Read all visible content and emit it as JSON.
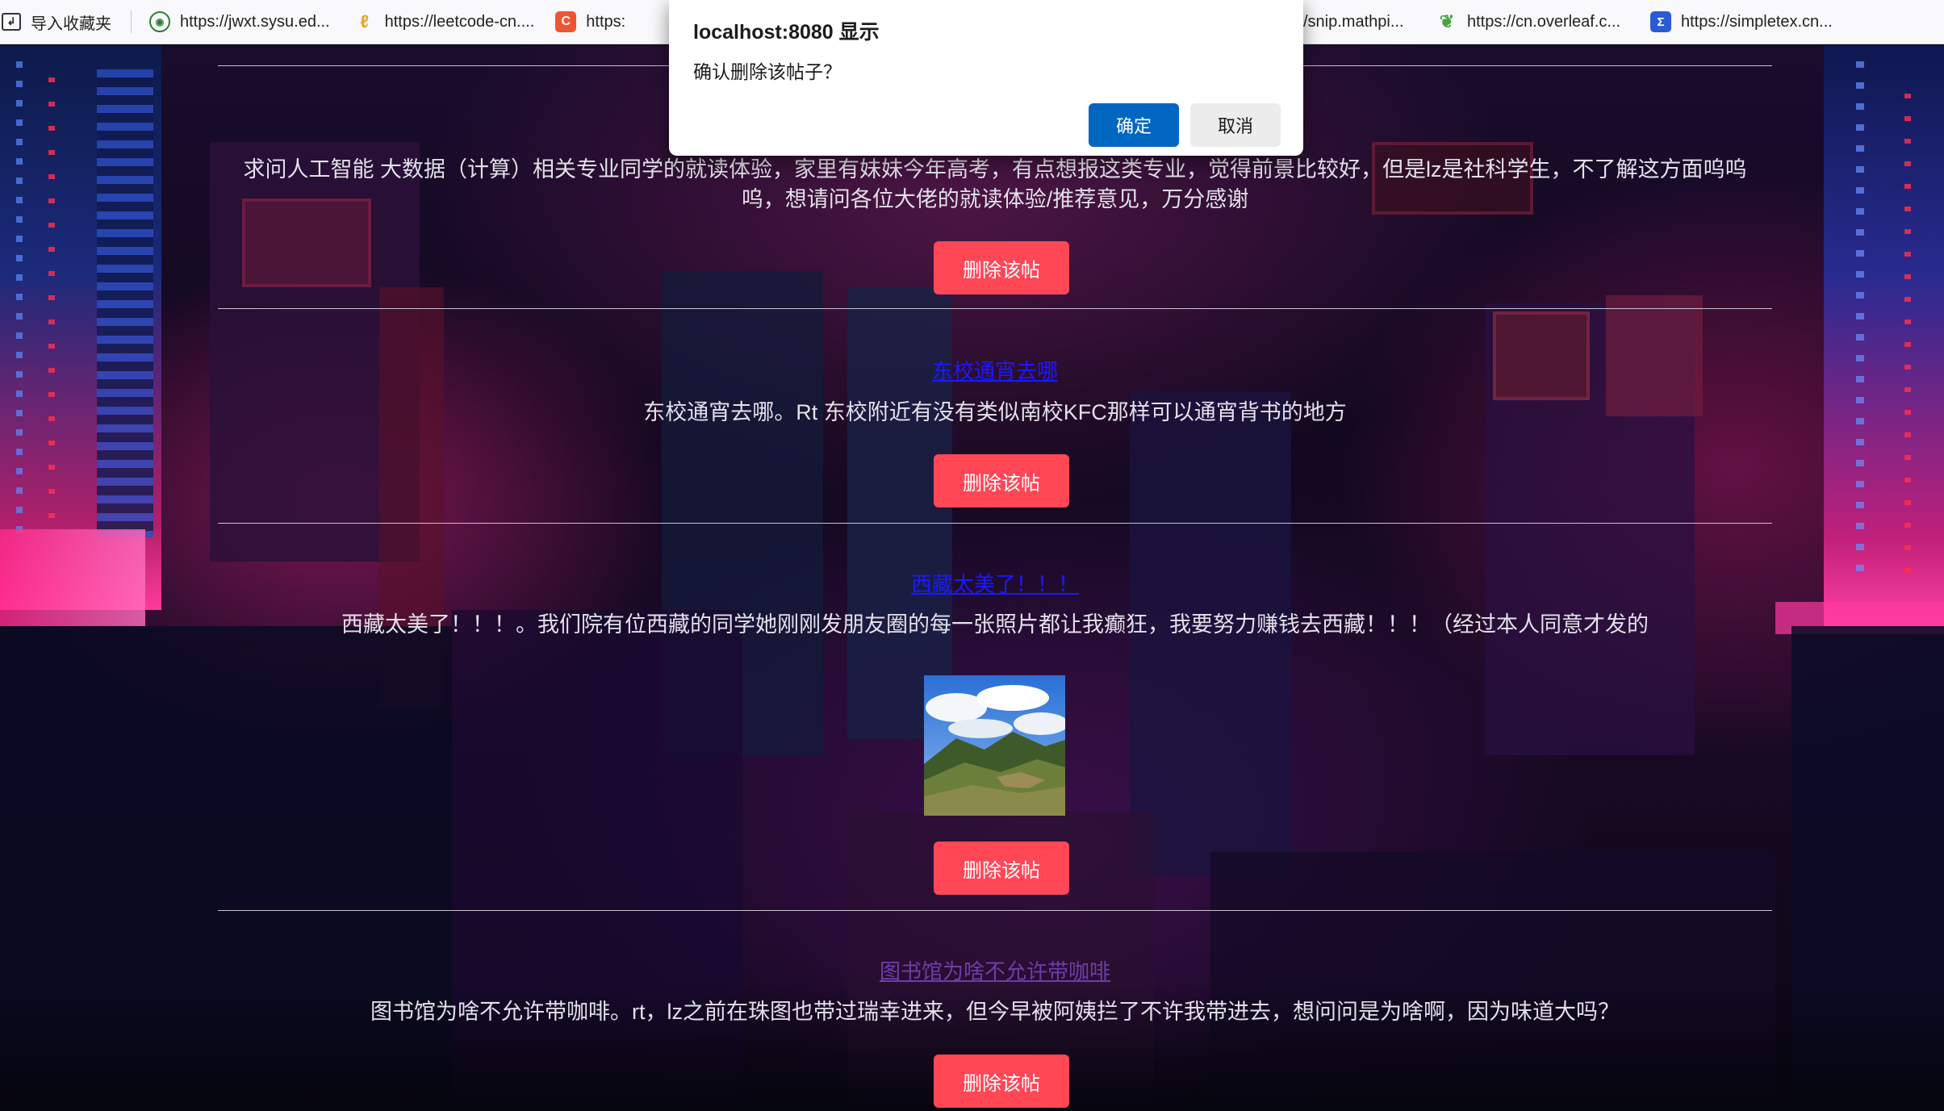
{
  "bookmarks": [
    {
      "label": "导入收藏夹",
      "icon": "import-icon"
    },
    {
      "label": "https://jwxt.sysu.ed...",
      "icon": "sysu-icon"
    },
    {
      "label": "https://leetcode-cn....",
      "icon": "leetcode-icon"
    },
    {
      "label": "https:",
      "icon": "c-icon"
    },
    {
      "label": "/snip.mathpi...",
      "icon": ""
    },
    {
      "label": "https://cn.overleaf.c...",
      "icon": "overleaf-icon"
    },
    {
      "label": "https://simpletex.cn...",
      "icon": "simpletex-icon"
    }
  ],
  "dialog": {
    "title": "localhost:8080 显示",
    "message": "确认删除该帖子？",
    "ok_label": "确定",
    "cancel_label": "取消"
  },
  "posts": [
    {
      "title": "",
      "body": "求问人工智能 大数据（计算）相关专业同学的就读体验，家里有妹妹今年高考，有点想报这类专业，觉得前景比较好，但是lz是社科学生，不了解这方面呜呜呜，想请问各位大佬的就读体验/推荐意见，万分感谢",
      "delete_label": "删除该帖"
    },
    {
      "title": "东校通宵去哪",
      "body": "东校通宵去哪。Rt 东校附近有没有类似南校KFC那样可以通宵背书的地方",
      "delete_label": "删除该帖"
    },
    {
      "title": "西藏太美了！！！",
      "body": "西藏太美了！！！。我们院有位西藏的同学她刚刚发朋友圈的每一张照片都让我癫狂，我要努力赚钱去西藏！！！（经过本人同意才发的",
      "delete_label": "删除该帖",
      "has_photo": true
    },
    {
      "title": "图书馆为啥不允许带咖啡",
      "body": "图书馆为啥不允许带咖啡。rt，lz之前在珠图也带过瑞幸进来，但今早被阿姨拦了不许我带进去，想问问是为啥啊，因为味道大吗？",
      "delete_label": "删除该帖"
    }
  ]
}
